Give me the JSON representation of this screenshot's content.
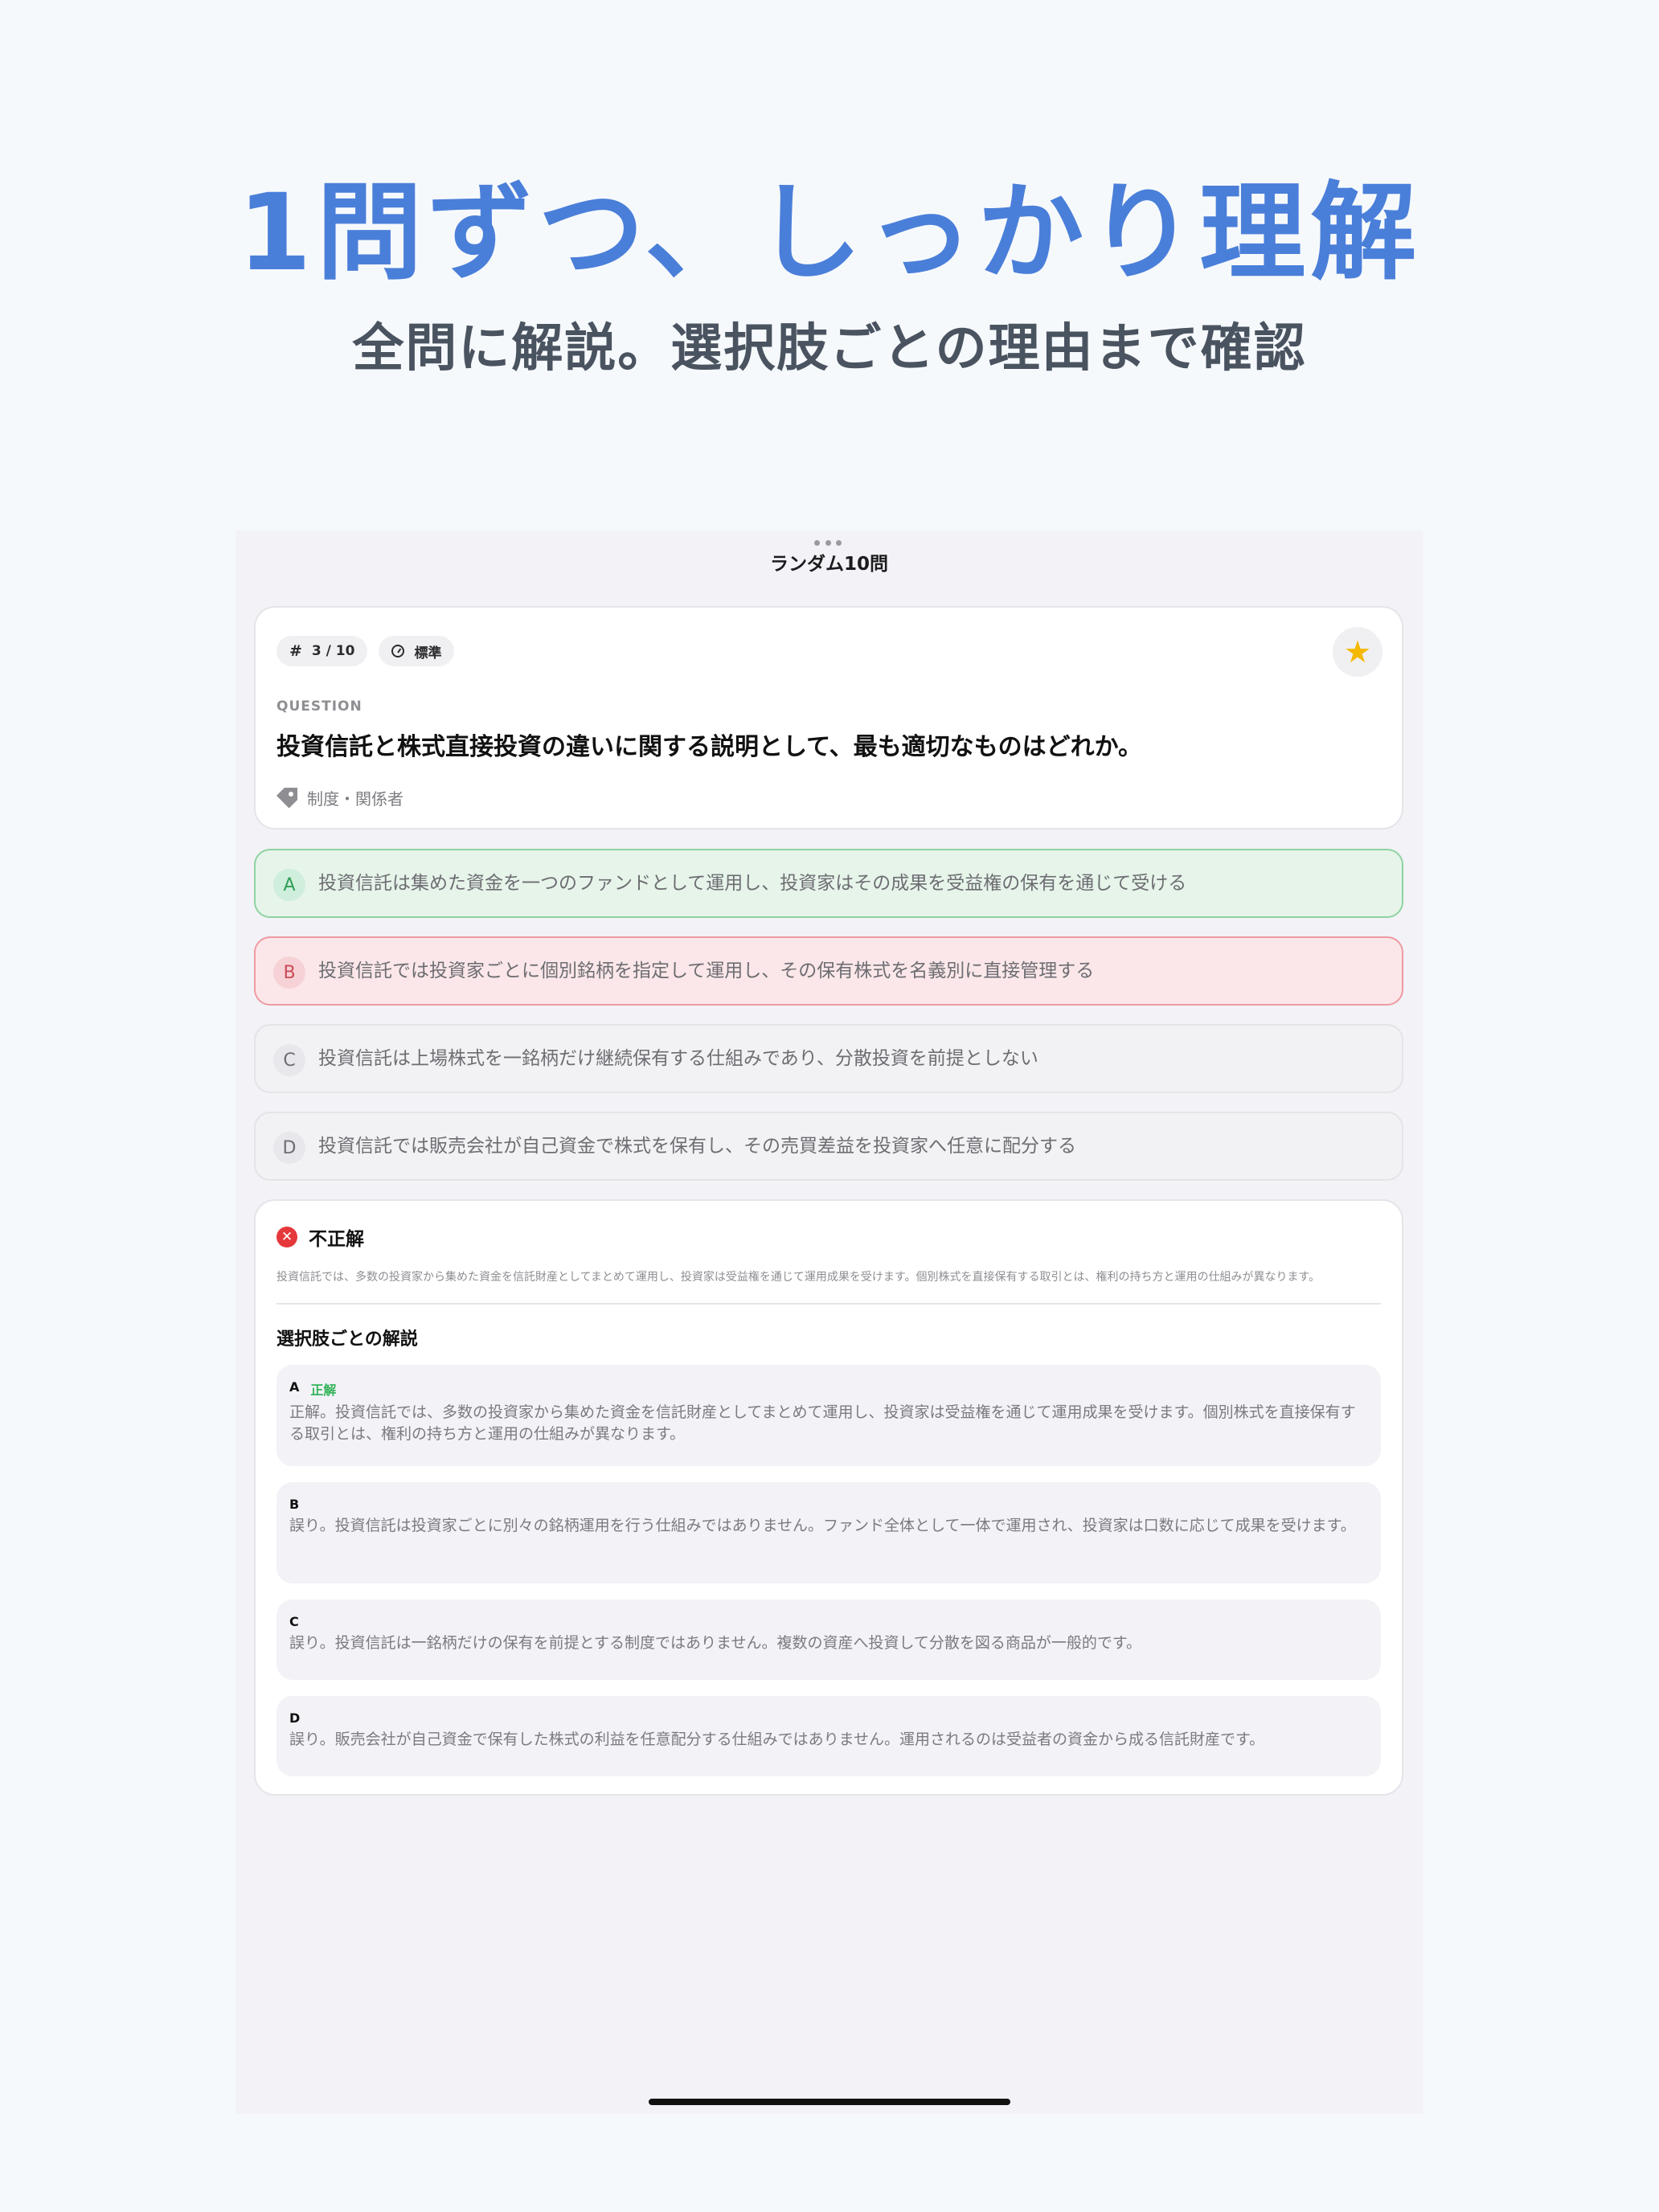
{
  "promo": {
    "headline": "1問ずつ、しっかり理解",
    "subheadline": "全問に解説。選択肢ごとの理由まで確認"
  },
  "nav": {
    "title": "ランダム10問"
  },
  "question": {
    "number_chip": "3 / 10",
    "difficulty_chip": "標準",
    "label": "QUESTION",
    "text": "投資信託と株式直接投資の違いに関する説明として、最も適切なものはどれか。",
    "tag": "制度・関係者",
    "favorite_icon": "star-icon"
  },
  "choices": [
    {
      "letter": "A",
      "text": "投資信託は集めた資金を一つのファンドとして運用し、投資家はその成果を受益権の保有を通じて受ける",
      "state": "correct"
    },
    {
      "letter": "B",
      "text": "投資信託では投資家ごとに個別銘柄を指定して運用し、その保有株式を名義別に直接管理する",
      "state": "wrong"
    },
    {
      "letter": "C",
      "text": "投資信託は上場株式を一銘柄だけ継続保有する仕組みであり、分散投資を前提としない",
      "state": "neutral"
    },
    {
      "letter": "D",
      "text": "投資信託では販売会社が自己資金で株式を保有し、その売買差益を投資家へ任意に配分する",
      "state": "neutral"
    }
  ],
  "explanation": {
    "result_label": "不正解",
    "summary": "投資信託では、多数の投資家から集めた資金を信託財産としてまとめて運用し、投資家は受益権を通じて運用成果を受けます。個別株式を直接保有する取引とは、権利の持ち方と運用の仕組みが異なります。",
    "section_title": "選択肢ごとの解説",
    "items": [
      {
        "letter": "A",
        "badge": "正解",
        "text": "正解。投資信託では、多数の投資家から集めた資金を信託財産としてまとめて運用し、投資家は受益権を通じて運用成果を受けます。個別株式を直接保有する取引とは、権利の持ち方と運用の仕組みが異なります。"
      },
      {
        "letter": "B",
        "badge": "",
        "text": "誤り。投資信託は投資家ごとに別々の銘柄運用を行う仕組みではありません。ファンド全体として一体で運用され、投資家は口数に応じて成果を受けます。"
      },
      {
        "letter": "C",
        "badge": "",
        "text": "誤り。投資信託は一銘柄だけの保有を前提とする制度ではありません。複数の資産へ投資して分散を図る商品が一般的です。"
      },
      {
        "letter": "D",
        "badge": "",
        "text": "誤り。販売会社が自己資金で保有した株式の利益を任意配分する仕組みではありません。運用されるのは受益者の資金から成る信託財産です。"
      }
    ]
  },
  "colors": {
    "headline": "#4a7fd9",
    "correct": "#34b35a",
    "wrong": "#e5383b",
    "star": "#f5b800"
  }
}
